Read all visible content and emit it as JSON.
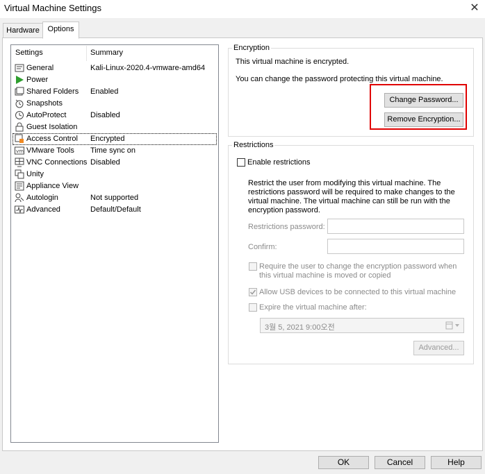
{
  "window": {
    "title": "Virtual Machine Settings",
    "close_glyph": "✕"
  },
  "tabs": [
    {
      "label": "Hardware",
      "active": false
    },
    {
      "label": "Options",
      "active": true
    }
  ],
  "settings_list": {
    "header_settings": "Settings",
    "header_summary": "Summary",
    "items": [
      {
        "name": "General",
        "summary": "Kali-Linux-2020.4-vmware-amd64",
        "icon": "general-icon"
      },
      {
        "name": "Power",
        "summary": "",
        "icon": "power-icon"
      },
      {
        "name": "Shared Folders",
        "summary": "Enabled",
        "icon": "shared-folders-icon"
      },
      {
        "name": "Snapshots",
        "summary": "",
        "icon": "snapshots-icon"
      },
      {
        "name": "AutoProtect",
        "summary": "Disabled",
        "icon": "autoprotect-icon"
      },
      {
        "name": "Guest Isolation",
        "summary": "",
        "icon": "lock-icon"
      },
      {
        "name": "Access Control",
        "summary": "Encrypted",
        "icon": "access-control-icon",
        "selected": true
      },
      {
        "name": "VMware Tools",
        "summary": "Time sync on",
        "icon": "vmware-tools-icon"
      },
      {
        "name": "VNC Connections",
        "summary": "Disabled",
        "icon": "vnc-icon"
      },
      {
        "name": "Unity",
        "summary": "",
        "icon": "unity-icon"
      },
      {
        "name": "Appliance View",
        "summary": "",
        "icon": "appliance-view-icon"
      },
      {
        "name": "Autologin",
        "summary": "Not supported",
        "icon": "autologin-icon"
      },
      {
        "name": "Advanced",
        "summary": "Default/Default",
        "icon": "advanced-icon"
      }
    ]
  },
  "encryption": {
    "label": "Encryption",
    "status_text": "This virtual machine is encrypted.",
    "info_text": "You can change the password protecting this virtual machine.",
    "change_password_button": "Change Password...",
    "remove_encryption_button": "Remove Encryption...",
    "highlight_color": "#e00000"
  },
  "restrictions": {
    "label": "Restrictions",
    "enable_label": "Enable restrictions",
    "description": "Restrict the user from modifying this virtual machine. The restrictions password will be required to make changes to the virtual machine. The virtual machine can still be run with the encryption password.",
    "password_label": "Restrictions password:",
    "password_value": "",
    "confirm_label": "Confirm:",
    "confirm_value": "",
    "require_change_label": "Require the user to change the encryption password when this virtual machine is moved or copied",
    "require_change_checked": false,
    "allow_usb_label": "Allow USB devices to be connected to this virtual machine",
    "allow_usb_checked": true,
    "expire_label": "Expire the virtual machine after:",
    "expire_checked": false,
    "date_value": "3월  5, 2021  9:00오전",
    "advanced_button": "Advanced..."
  },
  "footer": {
    "ok_button": "OK",
    "cancel_button": "Cancel",
    "help_button": "Help"
  }
}
